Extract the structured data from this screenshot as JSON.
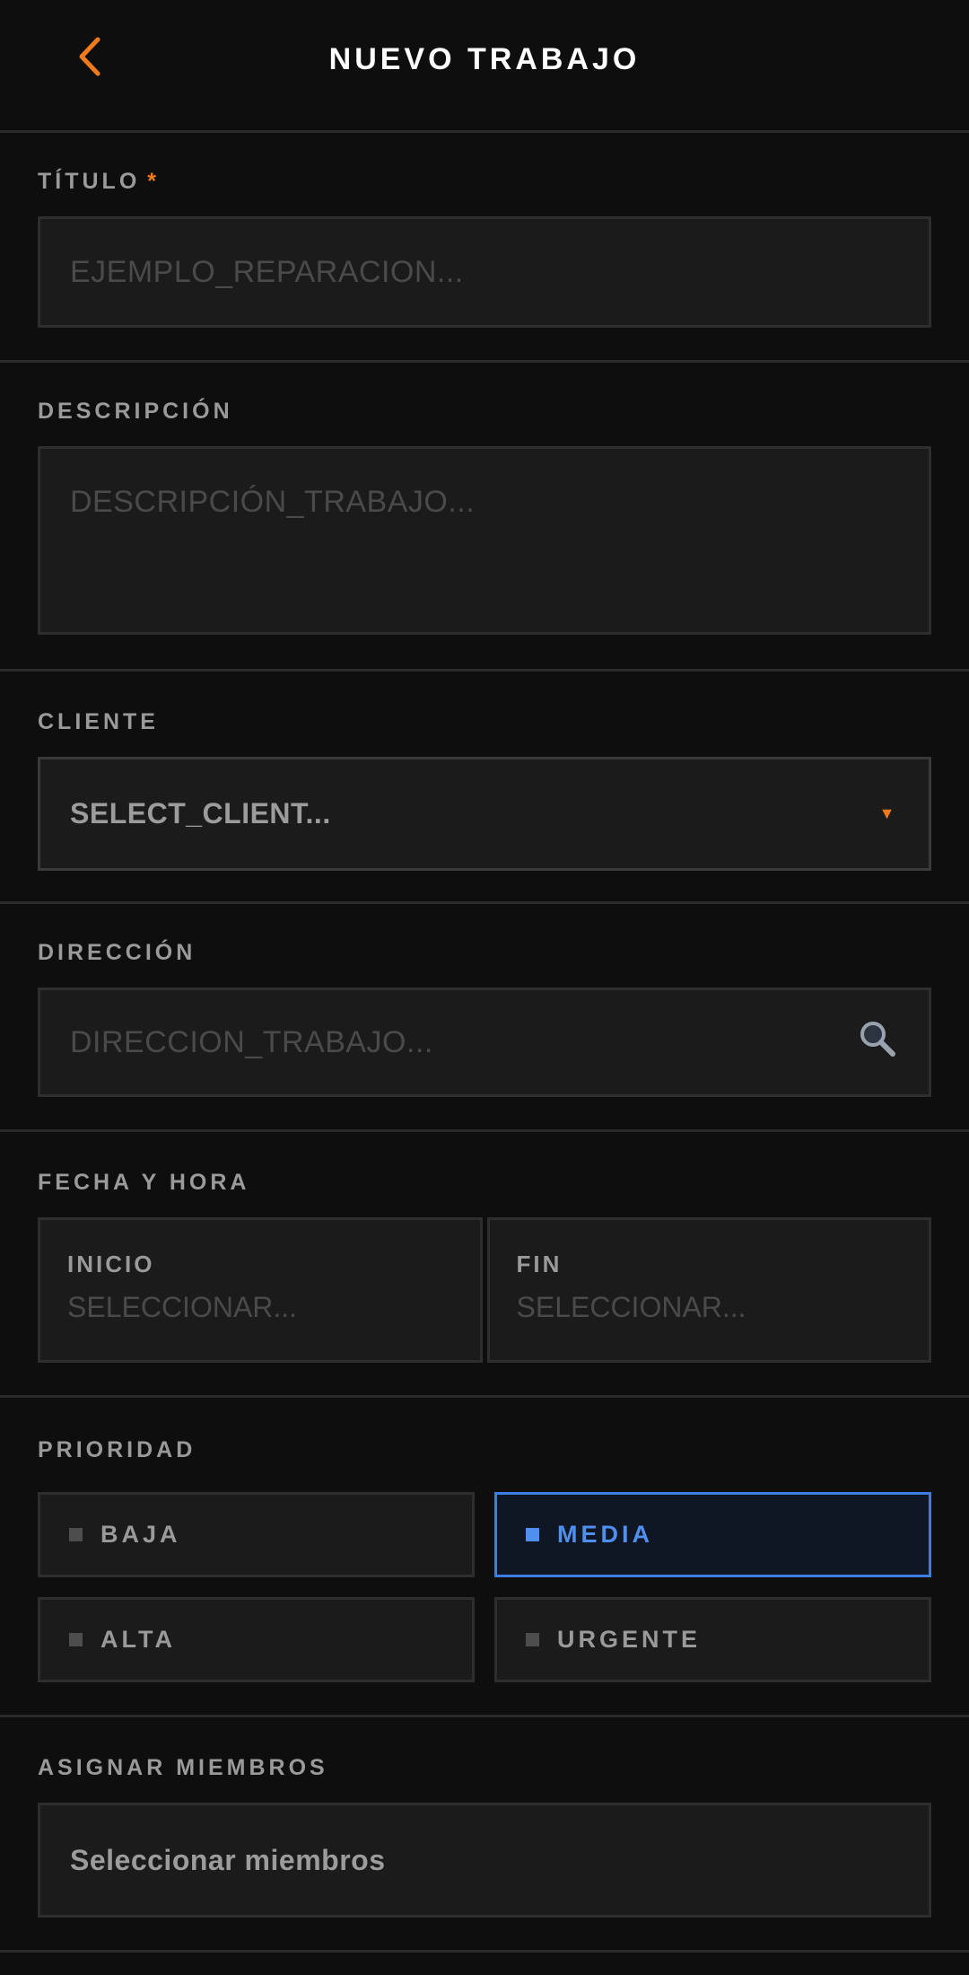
{
  "header": {
    "title": "NUEVO TRABAJO",
    "back_icon": "chevron-left-icon",
    "accent": "#f07a1e"
  },
  "titulo": {
    "label": "TÍTULO",
    "required_mark": "*",
    "placeholder": "EJEMPLO_REPARACION..."
  },
  "descripcion": {
    "label": "DESCRIPCIÓN",
    "placeholder": "DESCRIPCIÓN_TRABAJO..."
  },
  "cliente": {
    "label": "CLIENTE",
    "value": "SELECT_CLIENT...",
    "caret": "▼"
  },
  "direccion": {
    "label": "DIRECCIÓN",
    "placeholder": "DIRECCION_TRABAJO...",
    "icon": "search-icon"
  },
  "fecha": {
    "label": "FECHA Y HORA",
    "inicio": {
      "label": "INICIO",
      "placeholder": "SELECCIONAR..."
    },
    "fin": {
      "label": "FIN",
      "placeholder": "SELECCIONAR..."
    }
  },
  "prioridad": {
    "label": "PRIORIDAD",
    "selected": "MEDIA",
    "selected_color": "#4f8ff0",
    "options": [
      "BAJA",
      "MEDIA",
      "ALTA",
      "URGENTE"
    ]
  },
  "miembros": {
    "label": "ASIGNAR MIEMBROS",
    "value": "Seleccionar miembros"
  }
}
